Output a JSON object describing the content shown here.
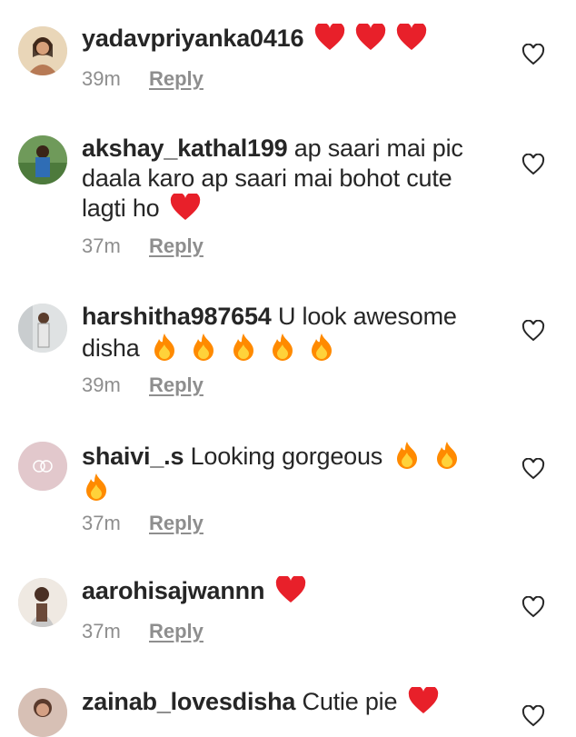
{
  "comments": [
    {
      "username": "yadavpriyanka0416",
      "text": "",
      "emoji": [
        "heart",
        "heart",
        "heart"
      ],
      "time": "39m",
      "reply_label": "Reply",
      "avatar_color": "#c9a27a"
    },
    {
      "username": "akshay_kathal199",
      "text": "ap saari mai pic daala karo ap saari mai bohot cute lagti ho",
      "emoji": [
        "heart"
      ],
      "time": "37m",
      "reply_label": "Reply",
      "avatar_color": "#3d6f4a"
    },
    {
      "username": "harshitha987654",
      "text": "U look awesome disha",
      "emoji": [
        "fire",
        "fire",
        "fire",
        "fire",
        "fire"
      ],
      "time": "39m",
      "reply_label": "Reply",
      "avatar_color": "#b9c0c4"
    },
    {
      "username": "shaivi_.s",
      "text": "Looking gorgeous",
      "emoji": [
        "fire",
        "fire",
        "fire"
      ],
      "time": "37m",
      "reply_label": "Reply",
      "avatar_color": "#e2c8cc"
    },
    {
      "username": "aarohisajwannn",
      "text": "",
      "emoji": [
        "heart"
      ],
      "time": "37m",
      "reply_label": "Reply",
      "avatar_color": "#d8d0c8"
    },
    {
      "username": "zainab_lovesdisha",
      "text": "Cutie pie",
      "emoji": [
        "heart"
      ],
      "time": "",
      "reply_label": "",
      "avatar_color": "#c8a89a"
    }
  ],
  "icons": {
    "like": "heart-outline-icon",
    "heart_emoji": "red-heart-emoji",
    "fire_emoji": "fire-emoji"
  },
  "colors": {
    "heart": "#e8202a",
    "fire": "#ff8a00",
    "meta": "#8e8e8e"
  }
}
